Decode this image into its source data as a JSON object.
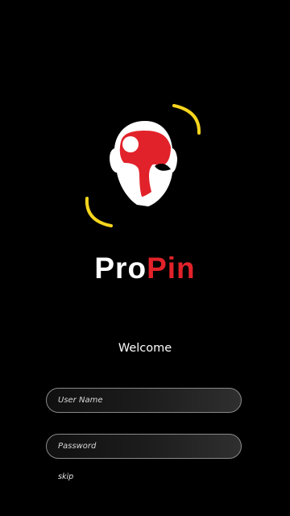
{
  "brand": {
    "name_part1": "Pro",
    "name_part2": "Pin",
    "color_primary": "#ffffff",
    "color_accent": "#e2222a",
    "logo_accent": "#f5d51e"
  },
  "welcome_text": "Welcome",
  "form": {
    "username": {
      "placeholder": "User Name",
      "value": ""
    },
    "password": {
      "placeholder": "Password",
      "value": ""
    }
  },
  "skip_label": "skip",
  "icons": {
    "logo": "head-logo-icon"
  }
}
